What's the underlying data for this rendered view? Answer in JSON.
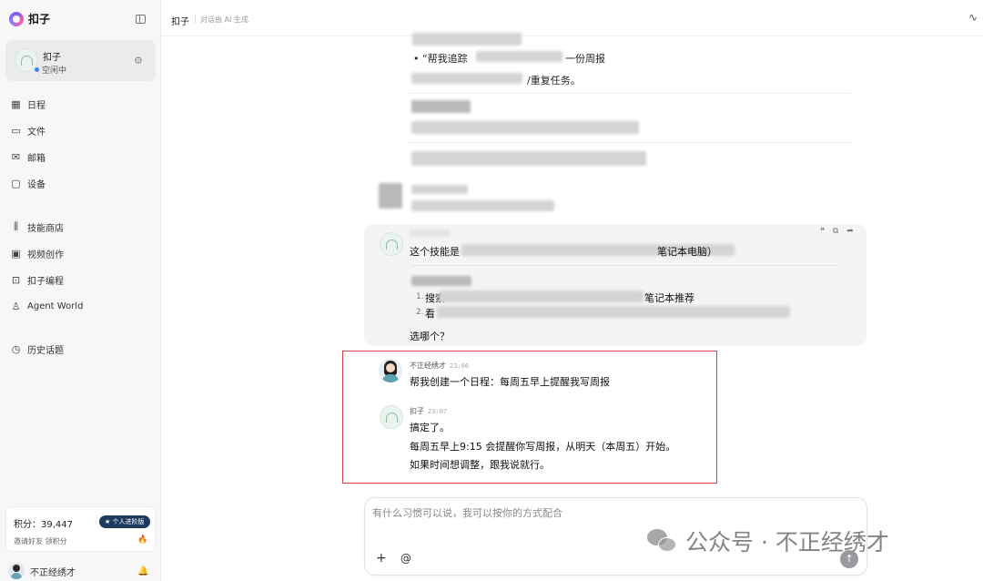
{
  "app": {
    "name": "扣子"
  },
  "agent_card": {
    "name": "扣子",
    "status": "空闲中"
  },
  "sidebar": {
    "items": [
      {
        "label": "日程",
        "icon": "calendar-icon"
      },
      {
        "label": "文件",
        "icon": "folder-icon"
      },
      {
        "label": "邮箱",
        "icon": "mail-icon"
      },
      {
        "label": "设备",
        "icon": "device-icon"
      },
      {
        "label": "技能商店",
        "icon": "skill-store-icon"
      },
      {
        "label": "视频创作",
        "icon": "video-icon"
      },
      {
        "label": "扣子编程",
        "icon": "code-icon"
      },
      {
        "label": "Agent World",
        "icon": "agent-icon"
      },
      {
        "label": "历史话题",
        "icon": "history-icon"
      }
    ],
    "points_label": "积分：39,447",
    "pro_badge": "★ 个人进阶版",
    "invite_label": "邀请好友 领积分",
    "user_name": "不正经绣才"
  },
  "header": {
    "title": "扣子",
    "subtitle": "对话由 AI 生成"
  },
  "chat": {
    "old_bullet_text": "• “帮我追踪",
    "old_bullet_tail": "一份周报",
    "old_line2_tail": "/重复任务。",
    "earlier_bot": {
      "intro_text": "这个技能是",
      "intro_tail": "笔记本电脑）",
      "list_numbers": [
        "1.",
        "2."
      ],
      "item1_text": "搜索",
      "item1_tail": "笔记本推荐",
      "item2_text": "看",
      "question": "选哪个？"
    },
    "user_message": {
      "author": "不正经绣才",
      "time": "23:06",
      "text": "帮我创建一个日程：每周五早上提醒我写周报"
    },
    "bot_reply": {
      "author": "扣子",
      "time": "23:07",
      "lines": [
        "搞定了。",
        "每周五早上9:15 会提醒你写周报，从明天（本周五）开始。",
        "如果时间想调整，跟我说就行。"
      ]
    }
  },
  "composer": {
    "placeholder": "有什么习惯可以说，我可以按你的方式配合"
  },
  "watermark": {
    "text": "公众号 · 不正经绣才"
  }
}
